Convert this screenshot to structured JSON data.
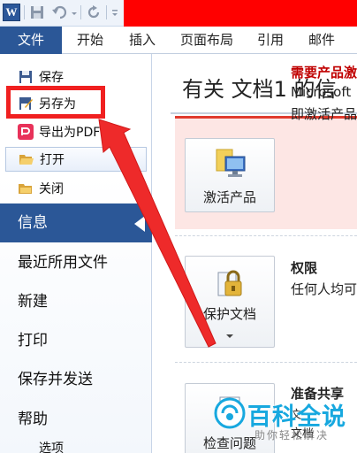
{
  "colors": {
    "file_tab": "#2b5797",
    "info_selected": "#2b5797",
    "activation_band": "#fde6e4",
    "activation_border": "#e03b2e",
    "highlight_red": "#f02020",
    "toolbar_red": "#ff0000"
  },
  "quick_access": {
    "app_icon": "W",
    "icons": [
      "word-app-icon",
      "save-icon",
      "undo-icon",
      "redo-icon",
      "customize-qat-icon"
    ]
  },
  "ribbon": {
    "tabs": [
      "文件",
      "开始",
      "插入",
      "页面布局",
      "引用",
      "邮件"
    ]
  },
  "backstage": {
    "commands": [
      {
        "label": "保存",
        "icon": "floppy-disk-icon"
      },
      {
        "label": "另存为",
        "icon": "save-as-icon"
      },
      {
        "label": "导出为PDF",
        "icon": "pdf-icon"
      },
      {
        "label": "打开",
        "icon": "open-folder-icon"
      },
      {
        "label": "关闭",
        "icon": "close-folder-icon"
      }
    ],
    "nav": [
      "信息",
      "最近所用文件",
      "新建",
      "打印",
      "保存并发送",
      "帮助",
      "选项"
    ]
  },
  "info": {
    "title": "有关 文档1 的信",
    "activate": {
      "button": "激活产品",
      "heading": "需要产品激",
      "desc_line1": "Microsoft",
      "desc_line2": "即激活产品"
    },
    "permissions": {
      "button": "保护文档",
      "heading": "权限",
      "desc": "任何人均可"
    },
    "prepare": {
      "button": "检查问题",
      "heading": "准备共享",
      "desc_line1": "文",
      "desc_line2": "文档"
    }
  },
  "watermark": {
    "title": "百科全说",
    "subtitle": "助你轻松解决"
  }
}
